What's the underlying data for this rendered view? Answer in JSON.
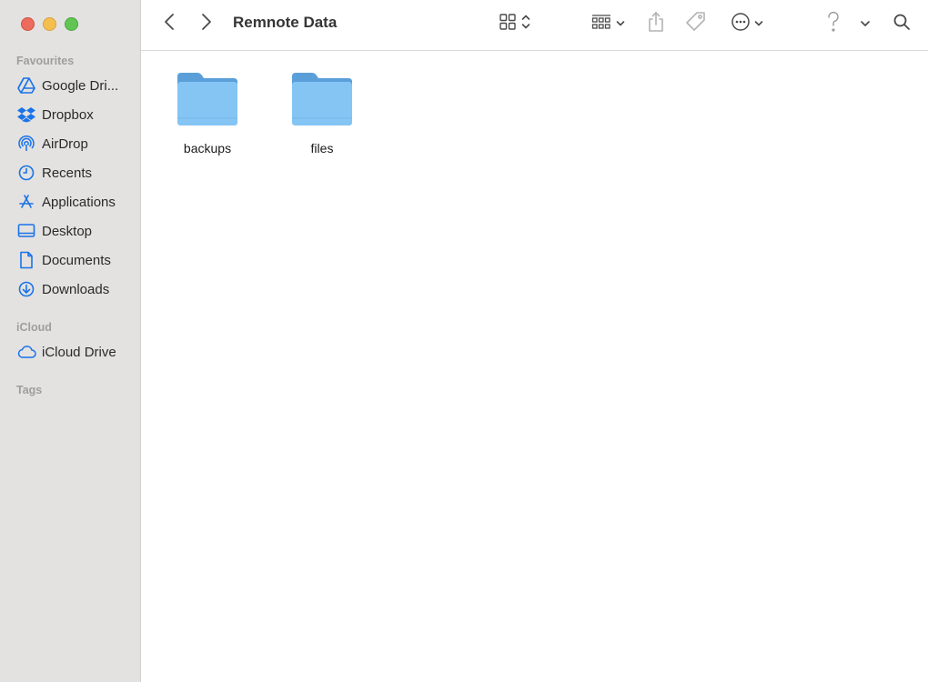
{
  "window": {
    "title": "Remnote Data"
  },
  "sidebar": {
    "sections": {
      "favourites": "Favourites",
      "icloud": "iCloud",
      "tags": "Tags"
    },
    "items": [
      {
        "label": "Google Dri...",
        "icon": "google-drive-icon"
      },
      {
        "label": "Dropbox",
        "icon": "dropbox-icon"
      },
      {
        "label": "AirDrop",
        "icon": "airdrop-icon"
      },
      {
        "label": "Recents",
        "icon": "clock-icon"
      },
      {
        "label": "Applications",
        "icon": "applications-icon"
      },
      {
        "label": "Desktop",
        "icon": "desktop-icon"
      },
      {
        "label": "Documents",
        "icon": "document-icon"
      },
      {
        "label": "Downloads",
        "icon": "download-icon"
      }
    ],
    "icloud_items": [
      {
        "label": "iCloud Drive",
        "icon": "cloud-icon"
      }
    ]
  },
  "content": {
    "folders": [
      {
        "name": "backups",
        "icon": "folder-icon"
      },
      {
        "name": "files",
        "icon": "folder-icon"
      }
    ]
  },
  "colors": {
    "accent": "#1a73e8",
    "folder": "#7cc0f2",
    "sidebar_bg": "#e3e2e1"
  }
}
